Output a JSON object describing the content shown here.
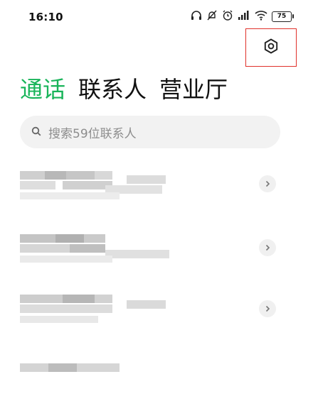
{
  "status_bar": {
    "time": "16:10",
    "battery": "75"
  },
  "tabs": [
    {
      "label": "通话",
      "active": true
    },
    {
      "label": "联系人",
      "active": false
    },
    {
      "label": "营业厅",
      "active": false
    }
  ],
  "search": {
    "placeholder": "搜索59位联系人"
  },
  "contacts": [
    {
      "name": ""
    },
    {
      "name": ""
    },
    {
      "name": ""
    },
    {
      "name": ""
    }
  ],
  "colors": {
    "accent": "#19b45a",
    "highlight_box": "#e0302a"
  }
}
